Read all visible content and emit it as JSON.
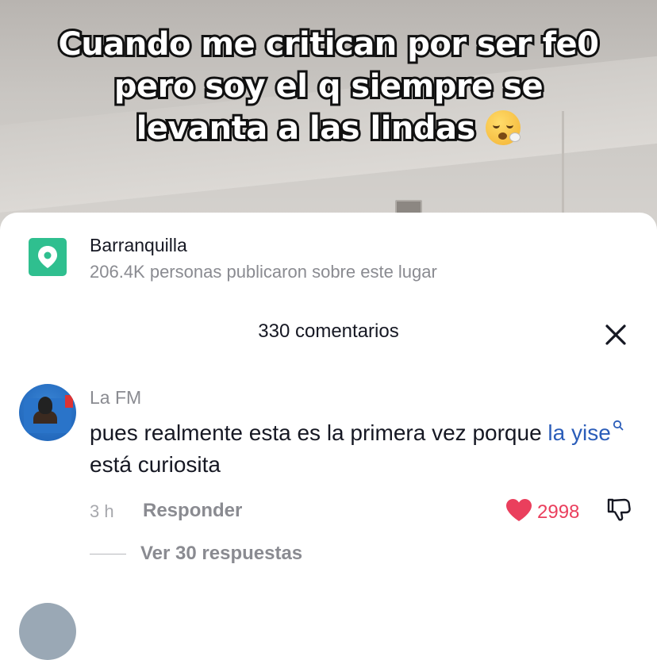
{
  "video": {
    "caption": "Cuando me critican por ser fe0 pero soy el q siempre se levanta a las lindas",
    "caption_emoji": "face-exhaling-emoji"
  },
  "place": {
    "name": "Barranquilla",
    "subtitle": "206.4K personas publicaron sobre este lugar",
    "icon": "location-pin-icon",
    "icon_color": "#2fbf8f"
  },
  "comments_header": {
    "count_label": "330 comentarios"
  },
  "comment": {
    "author": "La FM",
    "text_before": "pues realmente esta es la primera vez porque ",
    "mention": "la yise",
    "text_after": " está curiosita",
    "time": "3 h",
    "reply_label": "Responder",
    "likes": "2998",
    "like_color": "#ea3f5d",
    "view_replies_label": "Ver 30 respuestas"
  }
}
